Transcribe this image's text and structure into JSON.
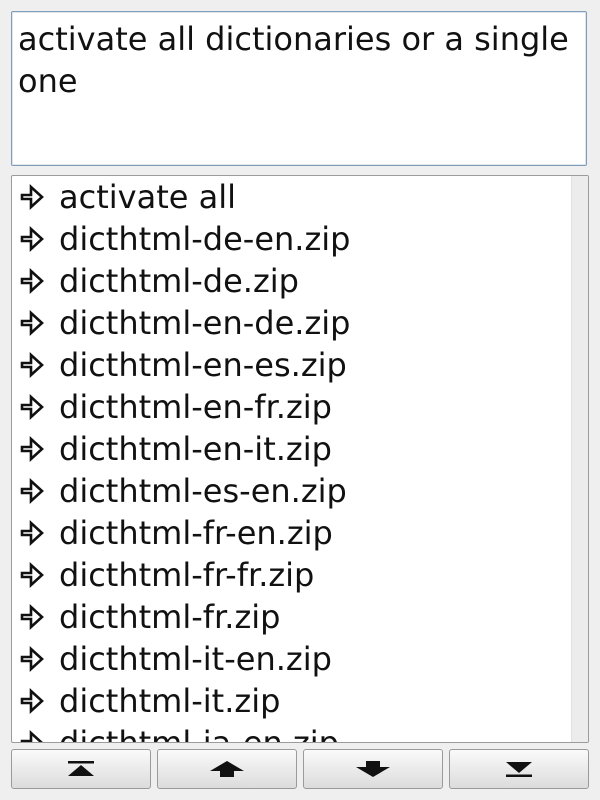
{
  "description": {
    "text": "activate all dictionaries or a single one"
  },
  "list": {
    "items": [
      {
        "label": "activate all",
        "icon": "arrow-right-icon"
      },
      {
        "label": "dicthtml-de-en.zip",
        "icon": "arrow-right-icon"
      },
      {
        "label": "dicthtml-de.zip",
        "icon": "arrow-right-icon"
      },
      {
        "label": "dicthtml-en-de.zip",
        "icon": "arrow-right-icon"
      },
      {
        "label": "dicthtml-en-es.zip",
        "icon": "arrow-right-icon"
      },
      {
        "label": "dicthtml-en-fr.zip",
        "icon": "arrow-right-icon"
      },
      {
        "label": "dicthtml-en-it.zip",
        "icon": "arrow-right-icon"
      },
      {
        "label": "dicthtml-es-en.zip",
        "icon": "arrow-right-icon"
      },
      {
        "label": "dicthtml-fr-en.zip",
        "icon": "arrow-right-icon"
      },
      {
        "label": "dicthtml-fr-fr.zip",
        "icon": "arrow-right-icon"
      },
      {
        "label": "dicthtml-fr.zip",
        "icon": "arrow-right-icon"
      },
      {
        "label": "dicthtml-it-en.zip",
        "icon": "arrow-right-icon"
      },
      {
        "label": "dicthtml-it.zip",
        "icon": "arrow-right-icon"
      },
      {
        "label": "dicthtml-ja-en.zip",
        "icon": "arrow-right-icon"
      }
    ]
  },
  "navigation": {
    "buttons": [
      {
        "name": "first-page-button",
        "icon": "skip-to-top-icon"
      },
      {
        "name": "previous-page-button",
        "icon": "arrow-up-icon"
      },
      {
        "name": "next-page-button",
        "icon": "arrow-down-icon"
      },
      {
        "name": "last-page-button",
        "icon": "skip-to-bottom-icon"
      }
    ]
  },
  "colors": {
    "background": "#efefef",
    "text": "#111111",
    "field_border": "#7f9db9"
  }
}
